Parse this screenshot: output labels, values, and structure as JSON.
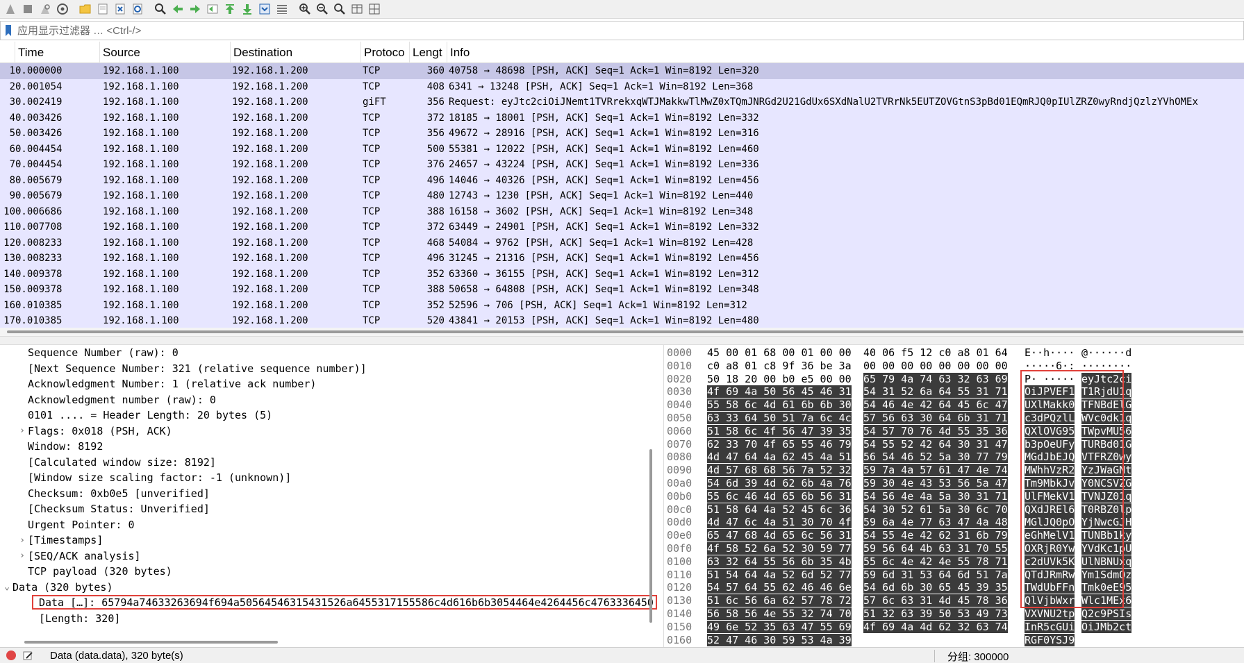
{
  "toolbar": {
    "icons": [
      "start-capture-icon",
      "stop-capture-icon",
      "restart-capture-icon",
      "capture-options-icon",
      "open-file-icon",
      "save-file-icon",
      "close-file-icon",
      "reload-file-icon",
      "find-packet-icon",
      "go-back-icon",
      "go-forward-icon",
      "go-to-packet-icon",
      "go-first-icon",
      "go-last-icon",
      "auto-scroll-icon",
      "colorize-icon",
      "zoom-in-icon",
      "zoom-out-icon",
      "normal-size-icon",
      "resize-columns-icon",
      "layout-icon"
    ]
  },
  "filter": {
    "placeholder": "应用显示过滤器 … <Ctrl-/>"
  },
  "packet_list": {
    "headers": {
      "time": "Time",
      "source": "Source",
      "destination": "Destination",
      "protocol": "Protoco",
      "length": "Lengt",
      "info": "Info"
    },
    "rows": [
      {
        "no": "1",
        "time": "0.000000",
        "src": "192.168.1.100",
        "dst": "192.168.1.200",
        "proto": "TCP",
        "len": "360",
        "info": "40758 → 48698 [PSH, ACK] Seq=1 Ack=1 Win=8192 Len=320"
      },
      {
        "no": "2",
        "time": "0.001054",
        "src": "192.168.1.100",
        "dst": "192.168.1.200",
        "proto": "TCP",
        "len": "408",
        "info": "6341 → 13248 [PSH, ACK] Seq=1 Ack=1 Win=8192 Len=368"
      },
      {
        "no": "3",
        "time": "0.002419",
        "src": "192.168.1.100",
        "dst": "192.168.1.200",
        "proto": "giFT",
        "len": "356",
        "info": "Request: eyJtc2ciOiJNemt1TVRrekxqWTJMakkwTlMwZ0xTQmJNRGd2U21GdUx6SXdNalU2TVRrNk5EUTZOVGtnS3pBd01EQmRJQ0pIUlZRZ0wyRndjQzlzYVhOMEx"
      },
      {
        "no": "4",
        "time": "0.003426",
        "src": "192.168.1.100",
        "dst": "192.168.1.200",
        "proto": "TCP",
        "len": "372",
        "info": "18185 → 18001 [PSH, ACK] Seq=1 Ack=1 Win=8192 Len=332"
      },
      {
        "no": "5",
        "time": "0.003426",
        "src": "192.168.1.100",
        "dst": "192.168.1.200",
        "proto": "TCP",
        "len": "356",
        "info": "49672 → 28916 [PSH, ACK] Seq=1 Ack=1 Win=8192 Len=316"
      },
      {
        "no": "6",
        "time": "0.004454",
        "src": "192.168.1.100",
        "dst": "192.168.1.200",
        "proto": "TCP",
        "len": "500",
        "info": "55381 → 12022 [PSH, ACK] Seq=1 Ack=1 Win=8192 Len=460"
      },
      {
        "no": "7",
        "time": "0.004454",
        "src": "192.168.1.100",
        "dst": "192.168.1.200",
        "proto": "TCP",
        "len": "376",
        "info": "24657 → 43224 [PSH, ACK] Seq=1 Ack=1 Win=8192 Len=336"
      },
      {
        "no": "8",
        "time": "0.005679",
        "src": "192.168.1.100",
        "dst": "192.168.1.200",
        "proto": "TCP",
        "len": "496",
        "info": "14046 → 40326 [PSH, ACK] Seq=1 Ack=1 Win=8192 Len=456"
      },
      {
        "no": "9",
        "time": "0.005679",
        "src": "192.168.1.100",
        "dst": "192.168.1.200",
        "proto": "TCP",
        "len": "480",
        "info": "12743 → 1230 [PSH, ACK] Seq=1 Ack=1 Win=8192 Len=440"
      },
      {
        "no": "10",
        "time": "0.006686",
        "src": "192.168.1.100",
        "dst": "192.168.1.200",
        "proto": "TCP",
        "len": "388",
        "info": "16158 → 3602 [PSH, ACK] Seq=1 Ack=1 Win=8192 Len=348"
      },
      {
        "no": "11",
        "time": "0.007708",
        "src": "192.168.1.100",
        "dst": "192.168.1.200",
        "proto": "TCP",
        "len": "372",
        "info": "63449 → 24901 [PSH, ACK] Seq=1 Ack=1 Win=8192 Len=332"
      },
      {
        "no": "12",
        "time": "0.008233",
        "src": "192.168.1.100",
        "dst": "192.168.1.200",
        "proto": "TCP",
        "len": "468",
        "info": "54084 → 9762 [PSH, ACK] Seq=1 Ack=1 Win=8192 Len=428"
      },
      {
        "no": "13",
        "time": "0.008233",
        "src": "192.168.1.100",
        "dst": "192.168.1.200",
        "proto": "TCP",
        "len": "496",
        "info": "31245 → 21316 [PSH, ACK] Seq=1 Ack=1 Win=8192 Len=456"
      },
      {
        "no": "14",
        "time": "0.009378",
        "src": "192.168.1.100",
        "dst": "192.168.1.200",
        "proto": "TCP",
        "len": "352",
        "info": "63360 → 36155 [PSH, ACK] Seq=1 Ack=1 Win=8192 Len=312"
      },
      {
        "no": "15",
        "time": "0.009378",
        "src": "192.168.1.100",
        "dst": "192.168.1.200",
        "proto": "TCP",
        "len": "388",
        "info": "50658 → 64808 [PSH, ACK] Seq=1 Ack=1 Win=8192 Len=348"
      },
      {
        "no": "16",
        "time": "0.010385",
        "src": "192.168.1.100",
        "dst": "192.168.1.200",
        "proto": "TCP",
        "len": "352",
        "info": "52596 → 706 [PSH, ACK] Seq=1 Ack=1 Win=8192 Len=312"
      },
      {
        "no": "17",
        "time": "0.010385",
        "src": "192.168.1.100",
        "dst": "192.168.1.200",
        "proto": "TCP",
        "len": "520",
        "info": "43841 → 20153 [PSH, ACK] Seq=1 Ack=1 Win=8192 Len=480"
      }
    ]
  },
  "detail_tree": {
    "rows": [
      {
        "text": "Sequence Number (raw): 0",
        "arrow": ""
      },
      {
        "text": "[Next Sequence Number: 321    (relative sequence number)]",
        "arrow": ""
      },
      {
        "text": "Acknowledgment Number: 1    (relative ack number)",
        "arrow": ""
      },
      {
        "text": "Acknowledgment number (raw): 0",
        "arrow": ""
      },
      {
        "text": "0101 .... = Header Length: 20 bytes (5)",
        "arrow": ""
      },
      {
        "text": "Flags: 0x018 (PSH, ACK)",
        "arrow": "›"
      },
      {
        "text": "Window: 8192",
        "arrow": ""
      },
      {
        "text": "[Calculated window size: 8192]",
        "arrow": ""
      },
      {
        "text": "[Window size scaling factor: -1 (unknown)]",
        "arrow": ""
      },
      {
        "text": "Checksum: 0xb0e5 [unverified]",
        "arrow": ""
      },
      {
        "text": "[Checksum Status: Unverified]",
        "arrow": ""
      },
      {
        "text": "Urgent Pointer: 0",
        "arrow": ""
      },
      {
        "text": "[Timestamps]",
        "arrow": "›"
      },
      {
        "text": "[SEQ/ACK analysis]",
        "arrow": "›"
      },
      {
        "text": "TCP payload (320 bytes)",
        "arrow": ""
      },
      {
        "text": "Data (320 bytes)",
        "arrow": "⌄"
      },
      {
        "text": "Data […]: 65794a74633263694f694a50564546315431526a6455317155586c4d616b6b3054464e4264456c4763336450",
        "arrow": ""
      },
      {
        "text": "[Length: 320]",
        "arrow": ""
      }
    ]
  },
  "hex_dump": {
    "rows": [
      {
        "off": "0000",
        "b1": "45 00 01 68 00 01 00 00",
        "b2": "40 06 f5 12 c0 a8 01 64",
        "a1": "E··h····",
        "a2": "@······d"
      },
      {
        "off": "0010",
        "b1": "c0 a8 01 c8 9f 36 be 3a",
        "b2": "00 00 00 00 00 00 00 00",
        "a1": "·····6·:",
        "a2": "········"
      },
      {
        "off": "0020",
        "b1": "50 18 20 00 b0 e5 00 00",
        "b2": "65 79 4a 74 63 32 63 69",
        "a1": "P· ·····",
        "a2": "eyJtc2ci"
      },
      {
        "off": "0030",
        "b1": "4f 69 4a 50 56 45 46 31",
        "b2": "54 31 52 6a 64 55 31 71",
        "a1": "OiJPVEF1",
        "a2": "T1RjdU1q"
      },
      {
        "off": "0040",
        "b1": "55 58 6c 4d 61 6b 6b 30",
        "b2": "54 46 4e 42 64 45 6c 47",
        "a1": "UXlMakk0",
        "a2": "TFNBdElG"
      },
      {
        "off": "0050",
        "b1": "63 33 64 50 51 7a 6c 4c",
        "b2": "57 56 63 30 64 6b 31 71",
        "a1": "c3dPQzlL",
        "a2": "WVc0dk1q"
      },
      {
        "off": "0060",
        "b1": "51 58 6c 4f 56 47 39 35",
        "b2": "54 57 70 76 4d 55 35 36",
        "a1": "QXlOVG95",
        "a2": "TWpvMU56"
      },
      {
        "off": "0070",
        "b1": "62 33 70 4f 65 55 46 79",
        "b2": "54 55 52 42 64 30 31 47",
        "a1": "b3pOeUFy",
        "a2": "TURBd01G"
      },
      {
        "off": "0080",
        "b1": "4d 47 64 4a 62 45 4a 51",
        "b2": "56 54 46 52 5a 30 77 79",
        "a1": "MGdJbEJQ",
        "a2": "VTFRZ0wy"
      },
      {
        "off": "0090",
        "b1": "4d 57 68 68 56 7a 52 32",
        "b2": "59 7a 4a 57 61 47 4e 74",
        "a1": "MWhhVzR2",
        "a2": "YzJWaGNt"
      },
      {
        "off": "00a0",
        "b1": "54 6d 39 4d 62 6b 4a 76",
        "b2": "59 30 4e 43 53 56 5a 47",
        "a1": "Tm9MbkJv",
        "a2": "Y0NCSVZG"
      },
      {
        "off": "00b0",
        "b1": "55 6c 46 4d 65 6b 56 31",
        "b2": "54 56 4e 4a 5a 30 31 71",
        "a1": "UlFMekV1",
        "a2": "TVNJZ01q"
      },
      {
        "off": "00c0",
        "b1": "51 58 64 4a 52 45 6c 36",
        "b2": "54 30 52 61 5a 30 6c 70",
        "a1": "QXdJREl6",
        "a2": "T0RBZ0lp"
      },
      {
        "off": "00d0",
        "b1": "4d 47 6c 4a 51 30 70 4f",
        "b2": "59 6a 4e 77 63 47 4a 48",
        "a1": "MGlJQ0pO",
        "a2": "YjNwcGJH"
      },
      {
        "off": "00e0",
        "b1": "65 47 68 4d 65 6c 56 31",
        "b2": "54 55 4e 42 62 31 6b 79",
        "a1": "eGhMelV1",
        "a2": "TUNBb1ky"
      },
      {
        "off": "00f0",
        "b1": "4f 58 52 6a 52 30 59 77",
        "b2": "59 56 64 4b 63 31 70 55",
        "a1": "OXRjR0Yw",
        "a2": "YVdKc1pU"
      },
      {
        "off": "0100",
        "b1": "63 32 64 55 56 6b 35 4b",
        "b2": "55 6c 4e 42 4e 55 78 71",
        "a1": "c2dUVk5K",
        "a2": "UlNBNUxq"
      },
      {
        "off": "0110",
        "b1": "51 54 64 4a 52 6d 52 77",
        "b2": "59 6d 31 53 64 6d 51 7a",
        "a1": "QTdJRmRw",
        "a2": "Ym1SdmQz"
      },
      {
        "off": "0120",
        "b1": "54 57 64 55 62 46 46 6e",
        "b2": "54 6d 6b 30 65 45 39 35",
        "a1": "TWdUbFFn",
        "a2": "Tmk0eE95"
      },
      {
        "off": "0130",
        "b1": "51 6c 56 6a 62 57 78 72",
        "b2": "57 6c 63 31 4d 45 78 36",
        "a1": "QlVjbWxr",
        "a2": "Wlc1MEx6"
      },
      {
        "off": "0140",
        "b1": "56 58 56 4e 55 32 74 70",
        "b2": "51 32 63 39 50 53 49 73",
        "a1": "VXVNU2tp",
        "a2": "Q2c9PSIs"
      },
      {
        "off": "0150",
        "b1": "49 6e 52 35 63 47 55 69",
        "b2": "4f 69 4a 4d 62 32 63 74",
        "a1": "InR5cGUi",
        "a2": "OiJMb2ct"
      },
      {
        "off": "0160",
        "b1": "52 47 46 30 59 53 4a 39",
        "b2": "",
        "a1": "RGF0YSJ9",
        "a2": ""
      }
    ]
  },
  "status": {
    "text": "Data (data.data), 320 byte(s)",
    "packets": "分组: 300000"
  },
  "colors": {
    "packet_row_bg": "#e7e6ff",
    "selected_row_bg": "#c6c6e6",
    "highlight_bg": "#3b3b3b",
    "annotation_red": "#e0413a"
  }
}
